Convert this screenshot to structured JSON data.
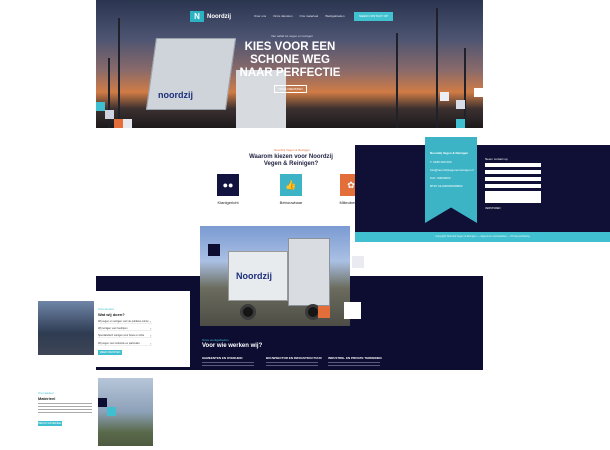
{
  "hero": {
    "brand": "Noordzij",
    "brand_mark": "N",
    "nav": [
      "Over ons",
      "Onze diensten",
      "Ons materieel",
      "Werkgebieden"
    ],
    "cta": "NEEM CONTACT OP",
    "kicker": "Van asfalt tot vegen en reinigen",
    "title": "KIES VOOR EEN SCHONE WEG NAAR PERFECTIE",
    "button": "ONZE DIENSTEN",
    "truck_label": "noordzij"
  },
  "why": {
    "kicker": "Noordzij Vegen & Reinigen",
    "title": "Waarom kiezen voor Noordzij Vegen & Reinigen?",
    "cards": [
      {
        "label": "Klantgericht",
        "icon": "people-icon",
        "color": "#131340"
      },
      {
        "label": "Betrouwbaar",
        "icon": "thumbs-up-icon",
        "color": "#3cb4c6"
      },
      {
        "label": "Milieubewust",
        "icon": "leaf-icon",
        "color": "#e36e3a"
      }
    ]
  },
  "contact": {
    "title": "Noordzij Vegen & Reinigen",
    "lines": [
      "T. 0180 000 000",
      "info@noordzijvegenenreinigen.nl",
      "KvK: 00000000",
      "BTW: NL000000000B00"
    ],
    "form_title": "Neem contact op",
    "submit": "VERSTUREN",
    "footer": "Copyright Noordzij Vegen & Reinigen — Algemene voorwaarden — Privacyverklaring"
  },
  "services": {
    "kicker": "Onze werkgebieden",
    "title": "Voor wie werken wij?",
    "columns": [
      "GEMEENTEN EN OVERHEID",
      "BOUWSECTOR EN INFRASTRUCTUUR",
      "INDUSTRIE- EN PRIVATE TERREINEN"
    ]
  },
  "what": {
    "kicker": "Onze diensten",
    "title": "Wat wij doen?",
    "items": [
      "Wij vegen en reinigen voor de publieke ruimte",
      "Wij reinigen voor bedrijven",
      "Specialistisch reinigen voor bouw en infra",
      "Wij vegen voor industrie en particulier"
    ],
    "button": "MEER DIENSTEN"
  },
  "materieel": {
    "kicker": "Ons materieel",
    "title": "Materieel",
    "button": "BEKIJK MATERIEEL"
  },
  "photo": {
    "truck_label": "Noordzij"
  },
  "colors": {
    "navy": "#0d0d32",
    "teal": "#3fbfcf",
    "orange": "#e36e3a"
  }
}
